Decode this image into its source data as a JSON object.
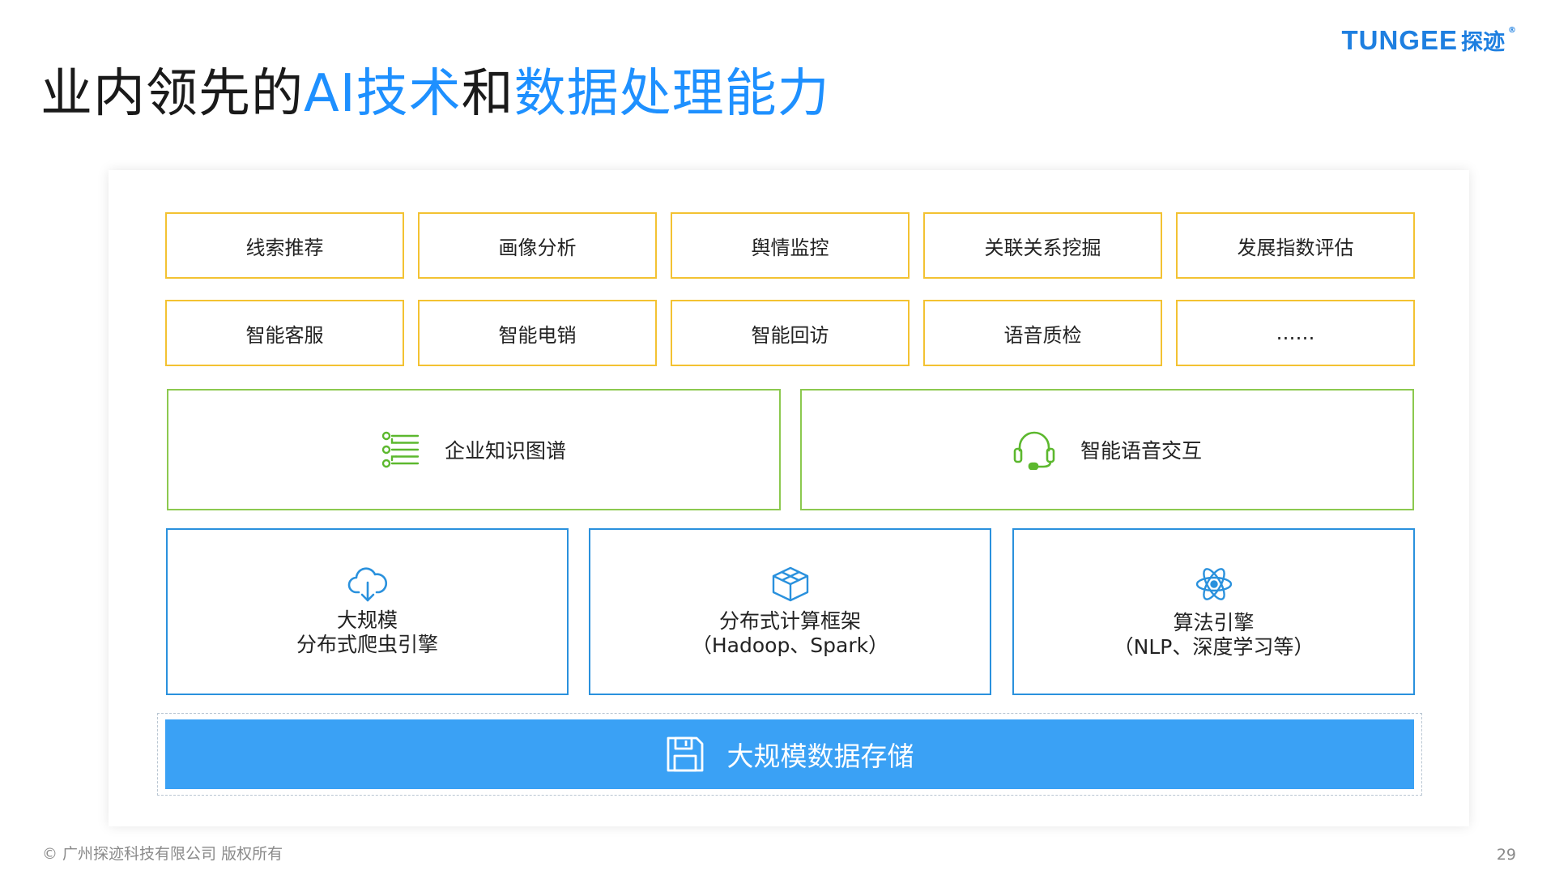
{
  "logo": {
    "text_en": "TUNGEE",
    "text_cn": "探迹",
    "registered": "®"
  },
  "title": {
    "parts": [
      {
        "text": "业内领先的",
        "tone": "dark"
      },
      {
        "text": "AI技术",
        "tone": "blue"
      },
      {
        "text": "和",
        "tone": "dark"
      },
      {
        "text": "数据处理能力",
        "tone": "blue"
      }
    ]
  },
  "applications": {
    "row1": [
      "线索推荐",
      "画像分析",
      "舆情监控",
      "关联关系挖掘",
      "发展指数评估"
    ],
    "row2": [
      "智能客服",
      "智能电销",
      "智能回访",
      "语音质检",
      "……"
    ]
  },
  "capabilities": [
    {
      "label": "企业知识图谱",
      "icon": "knowledge-graph-icon"
    },
    {
      "label": "智能语音交互",
      "icon": "headset-icon"
    }
  ],
  "engines": [
    {
      "line1": "大规模",
      "line2": "分布式爬虫引擎",
      "icon": "cloud-download-icon"
    },
    {
      "line1": "分布式计算框架",
      "line2": "（Hadoop、Spark）",
      "icon": "cube-icon"
    },
    {
      "line1": "算法引擎",
      "line2": "（NLP、深度学习等）",
      "icon": "atom-icon"
    }
  ],
  "storage": {
    "label": "大规模数据存储",
    "icon": "save-disk-icon"
  },
  "footer": {
    "copyright": "© 广州探迹科技有限公司 版权所有",
    "page_number": "29"
  },
  "colors": {
    "brand_blue": "#1e90ff",
    "application_border": "#f3c232",
    "capability_border": "#8cc94f",
    "engine_border": "#2a91dd",
    "storage_fill": "#3aa1f5"
  }
}
